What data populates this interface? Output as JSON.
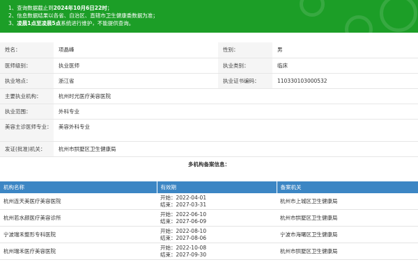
{
  "notice": {
    "lines": [
      {
        "num": "1、",
        "pre": "查询数据截止到",
        "bold": "2024年10月6日22时",
        "post": "；"
      },
      {
        "num": "2、",
        "pre": "信息数据结果以各省、自治区、直辖市卫生健康委数据为准；",
        "bold": "",
        "post": ""
      },
      {
        "num": "3、",
        "pre": "",
        "bold": "凌晨1点至凌晨5点",
        "post": "系统进行维护，不能提供查询。"
      }
    ]
  },
  "info": {
    "name_label": "姓名：",
    "name": "项晶峰",
    "gender_label": "性别：",
    "gender": "男",
    "level_label": "医师级别：",
    "level": "执业医师",
    "category_label": "执业类别：",
    "category": "临床",
    "location_label": "执业地点：",
    "location": "浙江省",
    "cert_label": "执业证书编码：",
    "cert": "110330103000532",
    "institution_label": "主要执业机构：",
    "institution": "杭州时光医疗美容医院",
    "scope_label": "执业范围：",
    "scope": "外科专业",
    "cosmetic_label": "美容主诊医师专业：",
    "cosmetic": "美容外科专业",
    "issuer_label": "发证(批准)机关：",
    "issuer": "杭州市拱墅区卫生健康局"
  },
  "multi": {
    "title": "多机构备案信息：",
    "headers": [
      "机构名称",
      "有效期",
      "备案机关"
    ],
    "rows": [
      {
        "org": "杭州连天美医疗美容医院",
        "start": "开始：2022-04-01",
        "end": "结束：2027-03-31",
        "authority": "杭州市上城区卫生健康局"
      },
      {
        "org": "杭州若水颜医疗美容诊所",
        "start": "开始：2022-06-10",
        "end": "结束：2027-06-09",
        "authority": "杭州市拱墅区卫生健康局"
      },
      {
        "org": "宁波瑞禾整形专科医院",
        "start": "开始：2022-08-10",
        "end": "结束：2027-08-06",
        "authority": "宁波市海曙区卫生健康局"
      },
      {
        "org": "杭州瑞禾医疗美容医院",
        "start": "开始：2022-10-08",
        "end": "结束：2027-09-30",
        "authority": "杭州市拱墅区卫生健康局"
      }
    ]
  },
  "colors": {
    "notice_bg": "#1c9e27",
    "header_bg": "#3c86c4",
    "label_bg": "#f5f5f5"
  }
}
